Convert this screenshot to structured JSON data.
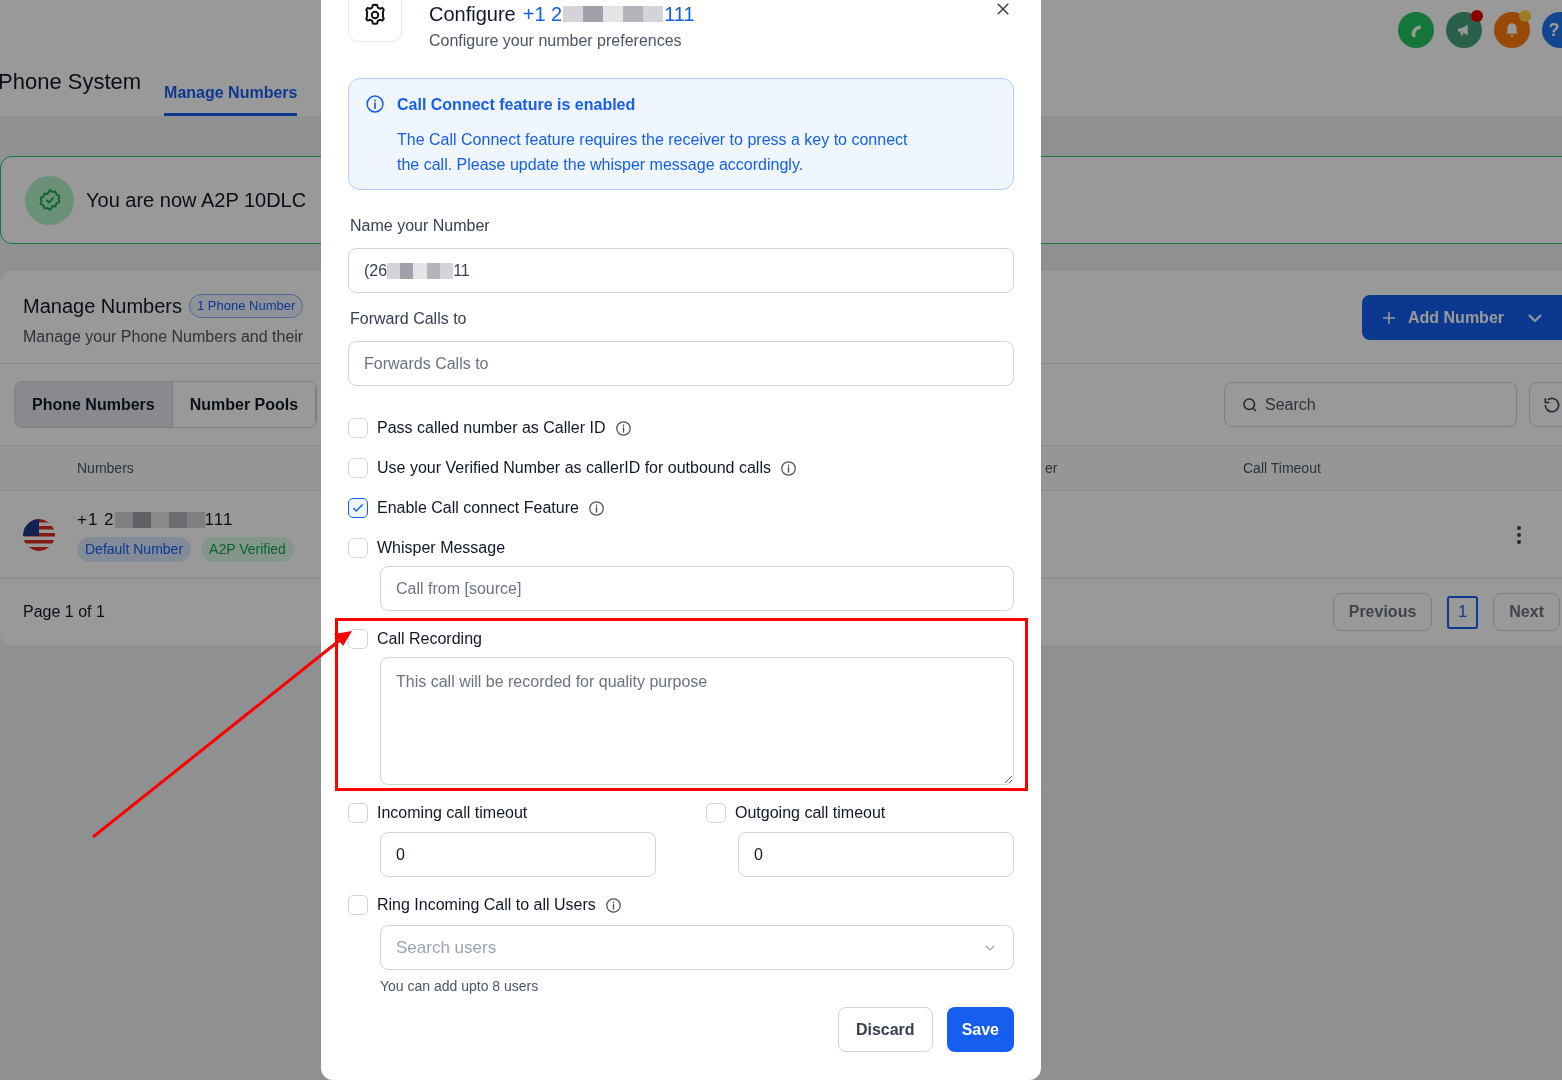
{
  "header": {
    "icons": [
      {
        "kind": "phone",
        "notification": false
      },
      {
        "kind": "megaphone",
        "notification": true
      },
      {
        "kind": "bell",
        "notification": true
      },
      {
        "kind": "help",
        "notification": false,
        "label": "?"
      }
    ]
  },
  "page": {
    "title": "Phone System",
    "tabs": [
      {
        "label": "Manage Numbers",
        "selected": true
      }
    ]
  },
  "banner": {
    "text": "You are now A2P 10DLC"
  },
  "section": {
    "title": "Manage Numbers",
    "badge": "1 Phone Number",
    "subtitle": "Manage your Phone Numbers and their",
    "add_button": "Add Number",
    "segments": [
      {
        "label": "Phone Numbers",
        "selected": true
      },
      {
        "label": "Number Pools",
        "selected": false
      }
    ],
    "search": {
      "placeholder": "Search"
    },
    "columns": [
      "Numbers",
      "er",
      "Call Timeout"
    ],
    "rows": [
      {
        "number_start": "+1 2",
        "number_end": "111",
        "tags": [
          {
            "label": "Default Number",
            "kind": "default"
          },
          {
            "label": "A2P Verified",
            "kind": "verified"
          }
        ]
      }
    ],
    "pagination": {
      "summary": "Page 1 of 1",
      "previous": "Previous",
      "pages": [
        {
          "label": "1",
          "selected": true
        }
      ],
      "next": "Next"
    }
  },
  "modal": {
    "title": "Configure",
    "title_number_start": "+1 2",
    "title_number_end": "111",
    "subtitle": "Configure your number preferences",
    "info": {
      "title": "Call Connect feature is enabled",
      "body": "The Call Connect feature requires the receiver to press a key to connect the call. Please update the whisper message accordingly."
    },
    "name_field": {
      "label": "Name your Number",
      "value_start": "(26",
      "value_end": "11"
    },
    "forward_field": {
      "label": "Forward Calls to",
      "placeholder": "Forwards Calls to"
    },
    "options": [
      {
        "kind": "checkbox",
        "label": "Pass called number as Caller ID",
        "checked": false,
        "info": true
      },
      {
        "kind": "checkbox",
        "label": "Use your Verified Number as callerID for outbound calls",
        "checked": false,
        "info": true
      },
      {
        "kind": "checkbox",
        "label": "Enable Call connect Feature",
        "checked": true,
        "info": true
      },
      {
        "kind": "input",
        "label": "Whisper Message",
        "checked": false,
        "info": false,
        "placeholder": "Call from [source]"
      },
      {
        "kind": "textarea",
        "label": "Call Recording",
        "checked": false,
        "info": false,
        "placeholder": "This call will be recorded for quality purpose"
      },
      {
        "kind": "pair",
        "items": [
          {
            "label": "Incoming call timeout",
            "checked": false,
            "value": "0"
          },
          {
            "label": "Outgoing call timeout",
            "checked": false,
            "value": "0"
          }
        ]
      },
      {
        "kind": "select",
        "label": "Ring Incoming Call to all Users",
        "checked": false,
        "info": true,
        "placeholder": "Search users",
        "hint": "You can add upto 8 users"
      }
    ],
    "buttons": {
      "discard": "Discard",
      "save": "Save"
    }
  }
}
